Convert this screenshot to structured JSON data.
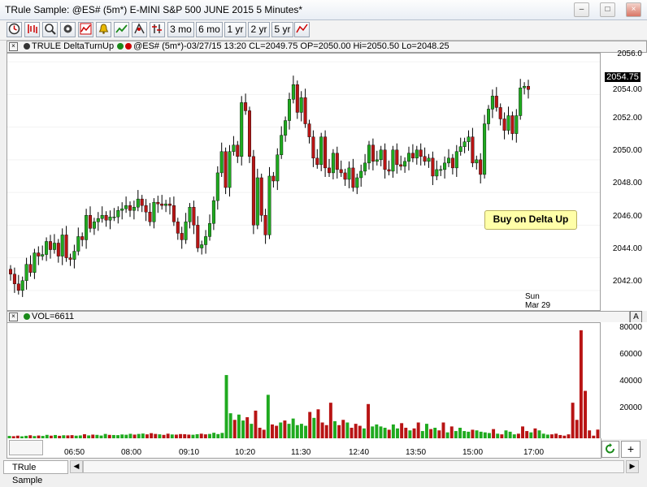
{
  "window": {
    "title": "TRule Sample: @ES# (5m*) E-MINI S&P 500 JUNE 2015 5 Minutes*",
    "min_label": "–",
    "max_label": "□",
    "close_label": "×"
  },
  "toolbar": {
    "range_buttons": [
      "3 mo",
      "6 mo",
      "1 yr",
      "2 yr",
      "5 yr"
    ]
  },
  "price_panel": {
    "header_study": "TRULE DeltaTurnUp",
    "header_info": "@ES# (5m*)-03/27/15 13:20 CL=2049.75 OP=2050.00 Hi=2050.50 Lo=2048.25",
    "y_ticks": [
      "2056.0",
      "2054.00",
      "2052.00",
      "2050.00",
      "2048.00",
      "2046.00",
      "2044.00",
      "2042.00"
    ],
    "last_price": "2054.75",
    "annotation": "Buy on Delta Up",
    "day_label": "Sun",
    "date_label": "Mar 29"
  },
  "volume_panel": {
    "header": "VOL=6611",
    "y_ticks": [
      "80000",
      "60000",
      "40000",
      "20000"
    ],
    "a_button": "A"
  },
  "time_axis": {
    "labels": [
      "06:50",
      "08:00",
      "09:10",
      "10:20",
      "11:30",
      "12:40",
      "13:50",
      "15:00",
      "17:00"
    ]
  },
  "bottom": {
    "tab": "TRule Sample",
    "plus": "+"
  },
  "colors": {
    "up": "#1faa1f",
    "down": "#b81414",
    "wick": "#000000"
  },
  "chart_data": {
    "type": "candlestick",
    "title": "@ES# (5m*) E-MINI S&P 500 JUNE 2015 5 Minutes",
    "ylim": [
      2040.8,
      2056.5
    ],
    "volume_ylim": [
      0,
      85000
    ],
    "x": [
      "06:50",
      "08:00",
      "09:10",
      "10:20",
      "11:30",
      "12:40",
      "13:50",
      "15:00",
      "17:00"
    ],
    "closes": [
      2043.0,
      2042.4,
      2042.0,
      2042.6,
      2043.6,
      2043.1,
      2044.3,
      2044.1,
      2044.2,
      2045.0,
      2044.5,
      2044.9,
      2044.1,
      2045.4,
      2044.0,
      2043.9,
      2044.4,
      2045.3,
      2045.1,
      2046.6,
      2045.8,
      2046.2,
      2046.4,
      2046.6,
      2046.3,
      2046.5,
      2046.5,
      2046.9,
      2047.0,
      2047.2,
      2046.9,
      2047.1,
      2047.6,
      2047.2,
      2046.8,
      2046.2,
      2047.4,
      2047.3,
      2047.2,
      2047.3,
      2047.2,
      2046.2,
      2045.5,
      2045.1,
      2046.2,
      2047.1,
      2046.0,
      2044.6,
      2044.8,
      2045.3,
      2046.1,
      2047.5,
      2049.2,
      2050.5,
      2048.3,
      2050.5,
      2050.9,
      2050.2,
      2053.5,
      2053.0,
      2050.2,
      2046.0,
      2048.9,
      2046.6,
      2045.4,
      2049.0,
      2048.7,
      2050.3,
      2051.5,
      2052.4,
      2053.7,
      2054.6,
      2052.9,
      2053.8,
      2052.2,
      2051.4,
      2050.1,
      2049.7,
      2051.4,
      2049.5,
      2049.2,
      2050.4,
      2049.4,
      2049.2,
      2048.8,
      2049.5,
      2048.3,
      2048.9,
      2049.3,
      2049.8,
      2050.9,
      2049.9,
      2050.0,
      2050.6,
      2049.4,
      2049.3,
      2050.6,
      2049.7,
      2049.6,
      2049.9,
      2050.4,
      2050.1,
      2050.6,
      2050.2,
      2049.9,
      2050.1,
      2049.0,
      2049.4,
      2049.4,
      2049.8,
      2050.1,
      2049.5,
      2050.5,
      2050.8,
      2051.1,
      2051.4,
      2049.8,
      2050.0,
      2049.1,
      2052.2,
      2053.1,
      2053.9,
      2053.2,
      2052.5,
      2051.8,
      2052.7,
      2051.6,
      2052.7,
      2054.4,
      2054.5,
      2054.3
    ],
    "volumes": [
      1800,
      1600,
      2000,
      1500,
      1900,
      2300,
      1700,
      2100,
      1800,
      2600,
      2000,
      2500,
      1900,
      2300,
      2200,
      2400,
      2000,
      2200,
      3100,
      2200,
      2800,
      2600,
      2100,
      3300,
      2600,
      2500,
      2400,
      2900,
      2700,
      3400,
      2800,
      3300,
      3600,
      3000,
      3900,
      3300,
      3000,
      2600,
      3500,
      2900,
      2800,
      3200,
      3100,
      2800,
      2700,
      3100,
      3500,
      3000,
      3300,
      4200,
      3200,
      4100,
      48000,
      19000,
      14000,
      18000,
      13500,
      16000,
      11000,
      21000,
      8000,
      6500,
      33000,
      10500,
      9500,
      12000,
      13500,
      11000,
      15000,
      10000,
      11000,
      9500,
      20000,
      15500,
      22000,
      12000,
      10000,
      27000,
      13000,
      10000,
      14000,
      12000,
      8000,
      11000,
      9500,
      7500,
      26000,
      9000,
      10500,
      9000,
      8000,
      6500,
      10500,
      7500,
      11500,
      8000,
      6000,
      7500,
      12000,
      5500,
      11000,
      7000,
      8000,
      6000,
      12000,
      4500,
      9000,
      5500,
      8000,
      5500,
      5000,
      6500,
      6000,
      5000,
      4500,
      4000,
      7000,
      3500,
      3000,
      6000,
      5000,
      3000,
      3500,
      9000,
      5500,
      4500,
      7500,
      6000,
      3500,
      2800,
      3000,
      3500,
      2500,
      2000,
      3000,
      27000,
      14000,
      82000,
      36000,
      6000,
      2000,
      6611
    ]
  }
}
